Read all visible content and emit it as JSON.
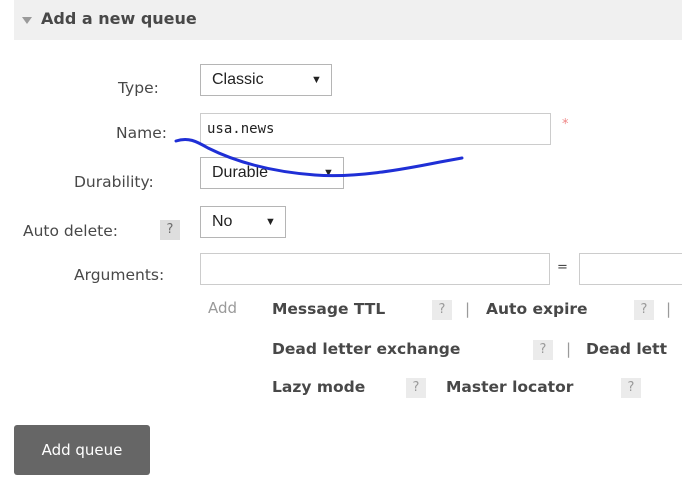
{
  "section": {
    "title": "Add a new queue"
  },
  "form": {
    "type": {
      "label": "Type:",
      "value": "Classic"
    },
    "name": {
      "label": "Name:",
      "value": "usa.news",
      "required_mark": "*"
    },
    "durability": {
      "label": "Durability:",
      "value": "Durable"
    },
    "auto_delete": {
      "label": "Auto delete:",
      "value": "No",
      "help": "?"
    },
    "arguments": {
      "label": "Arguments:",
      "equals": "=",
      "key": "",
      "value": ""
    }
  },
  "shortcuts": {
    "add_label": "Add",
    "separator": "|",
    "help": "?",
    "items": [
      "Message TTL",
      "Auto expire",
      "Dead letter exchange",
      "Dead lett",
      "Lazy mode",
      "Master locator"
    ]
  },
  "submit_label": "Add queue",
  "colors": {
    "annotation_ink": "#1f2fd6",
    "button_bg": "#666666",
    "required": "#ef8686"
  }
}
